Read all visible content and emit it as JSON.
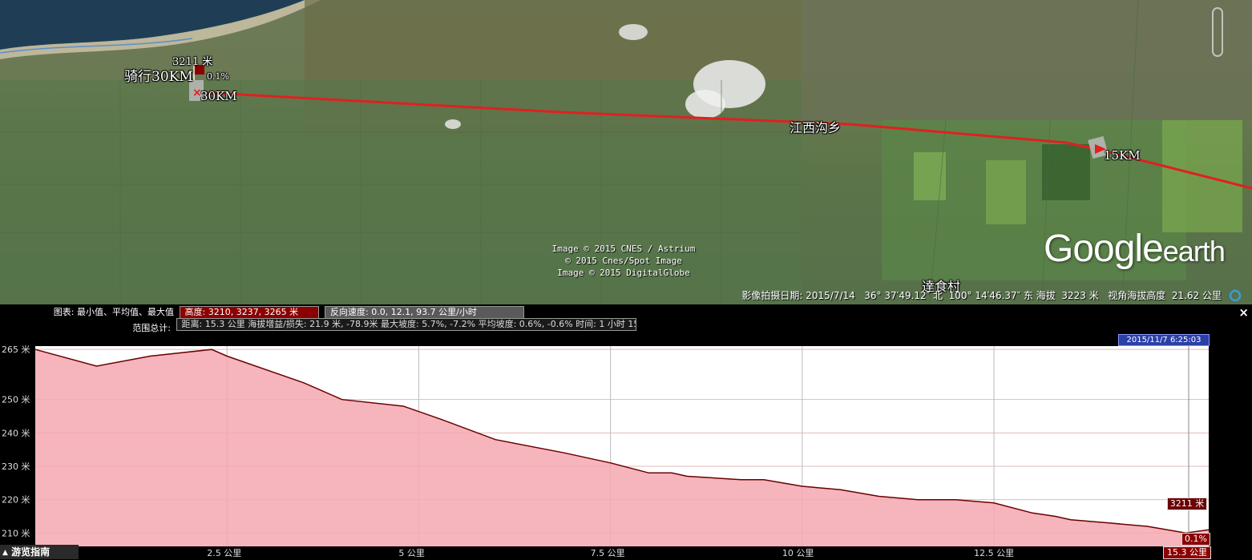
{
  "map": {
    "placemarks": {
      "start_elev": "3211 米",
      "start_name": "骑行30KM",
      "start_grade": "0.1%",
      "km30": "30KM",
      "town": "江西沟乡",
      "km15": "15KM",
      "village": "達食村"
    },
    "copyright": [
      "Image © 2015 CNES / Astrium",
      "© 2015 Cnes/Spot Image",
      "Image © 2015 DigitalGlobe"
    ],
    "logo_google": "Google",
    "logo_earth": "earth",
    "status": "影像拍摄日期: 2015/7/14   36° 37′49.12″ 北  100° 14′46.37″ 东 海拔  3223 米   视角海拔高度  21.62 公里",
    "route_color": "#e02020"
  },
  "profile": {
    "stats_label_1": "图表: 最小值、平均值、最大值",
    "stats_elev": "高度: 3210, 3237, 3265 米",
    "stats_speed": "反向速度: 0.0, 12.1, 93.7 公里/小时",
    "stats_label_2": "范围总计:",
    "stats_totals": "距离: 15.3 公里 海拔增益/损失: 21.9 米, -78.9米 最大坡度: 5.7%, -7.2% 平均坡度: 0.6%, -0.6% 时间: 1 小时 15 分钟 46 秒",
    "timestamp": "2015/11/7 6:25:03",
    "cursor_elev": "3211 米",
    "cursor_grade": "0.1%",
    "cursor_dist": "15.3 公里",
    "close_label": "×",
    "tour_guide": "游览指南",
    "tour_icon": "caret-up-icon"
  },
  "chart_data": {
    "type": "area",
    "xlabel": "",
    "ylabel": "",
    "xlim": [
      0,
      15.3
    ],
    "ylim": [
      3206,
      3266
    ],
    "x_unit": "公里",
    "y_unit": "米",
    "x_ticks": [
      2.5,
      5,
      7.5,
      10,
      12.5
    ],
    "x_tick_labels": [
      "2.5 公里",
      "5 公里",
      "7.5 公里",
      "10 公里",
      "12.5 公里"
    ],
    "y_ticks": [
      3210,
      3220,
      3230,
      3240,
      3250,
      3265
    ],
    "y_tick_labels": [
      "210 米",
      "220 米",
      "230 米",
      "240 米",
      "250 米",
      "265 米"
    ],
    "fill_color": "#f5a8b0",
    "line_color": "#6b0000",
    "x": [
      0,
      0.8,
      1.5,
      2.3,
      2.5,
      3.5,
      4.0,
      4.8,
      5.3,
      6.0,
      6.9,
      7.5,
      8.0,
      8.3,
      8.5,
      9.2,
      9.5,
      10.0,
      10.5,
      11.0,
      11.5,
      12.0,
      12.5,
      13.0,
      13.3,
      13.5,
      14.0,
      14.5,
      15.0,
      15.3
    ],
    "y": [
      3265,
      3260,
      3263,
      3265,
      3263,
      3255,
      3250,
      3248,
      3244,
      3238,
      3234,
      3231,
      3228,
      3228,
      3227,
      3226,
      3226,
      3224,
      3223,
      3221,
      3220,
      3220,
      3219,
      3216,
      3215,
      3214,
      3213,
      3212,
      3210,
      3211
    ]
  }
}
